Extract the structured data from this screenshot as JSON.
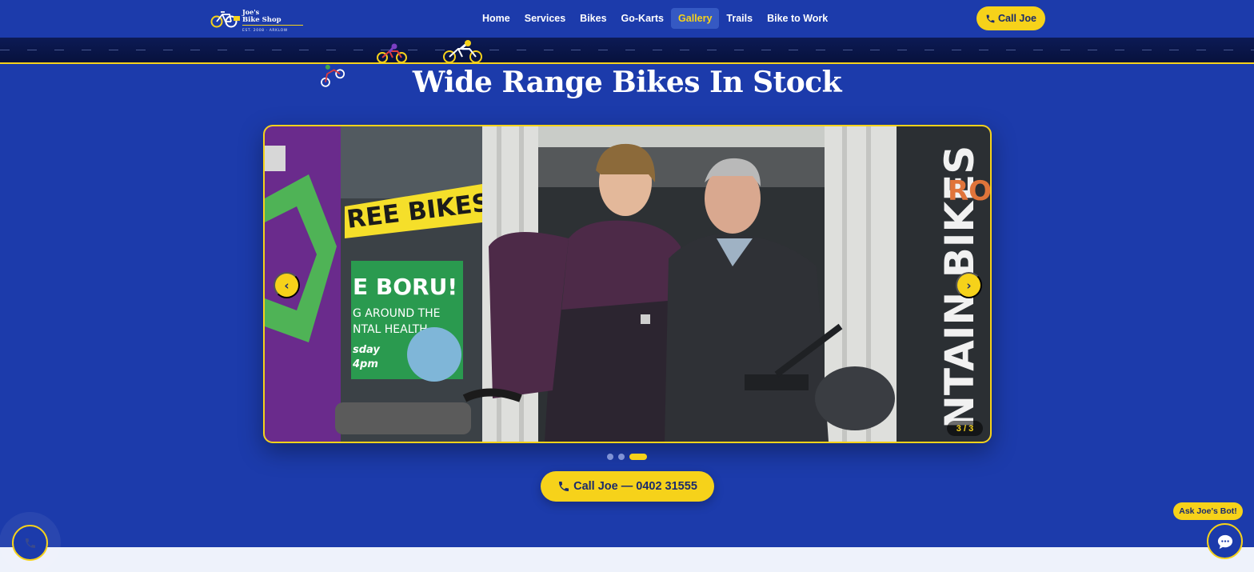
{
  "brand": {
    "name_line1": "Joe's",
    "name_line2": "Bike Shop",
    "tagline": "EST. 2008 · ARKLOW",
    "accent": "#f6d21a",
    "background": "#1c3bab"
  },
  "nav": {
    "items": [
      {
        "label": "Home",
        "active": false
      },
      {
        "label": "Services",
        "active": false
      },
      {
        "label": "Bikes",
        "active": false
      },
      {
        "label": "Go-Karts",
        "active": false
      },
      {
        "label": "Gallery",
        "active": true
      },
      {
        "label": "Trails",
        "active": false
      },
      {
        "label": "Bike to Work",
        "active": false
      }
    ],
    "call_label": "Call Joe",
    "call_icon": "phone-icon"
  },
  "hero": {
    "title": "Wide Range Bikes In Stock"
  },
  "carousel": {
    "prev_icon": "‹",
    "next_icon": "›",
    "counter": "3 / 3",
    "current_slide": 3,
    "total_slides": 3,
    "photo_text": {
      "banner": "REE BIKES",
      "poster_title": "E BORU!",
      "poster_line1": "G AROUND THE",
      "poster_line2": "NTAL HEALTH",
      "poster_line3": "sday",
      "poster_line4": "4pm",
      "sign": "NTAIN BIKES",
      "sign_top": "RO"
    }
  },
  "cta": {
    "label": "Call Joe — 0402 31555",
    "icon": "phone-icon"
  },
  "chatbot": {
    "label": "Ask Joe's Bot!",
    "icon": "chat-bubble-icon"
  },
  "floating_call": {
    "icon": "phone-icon"
  }
}
